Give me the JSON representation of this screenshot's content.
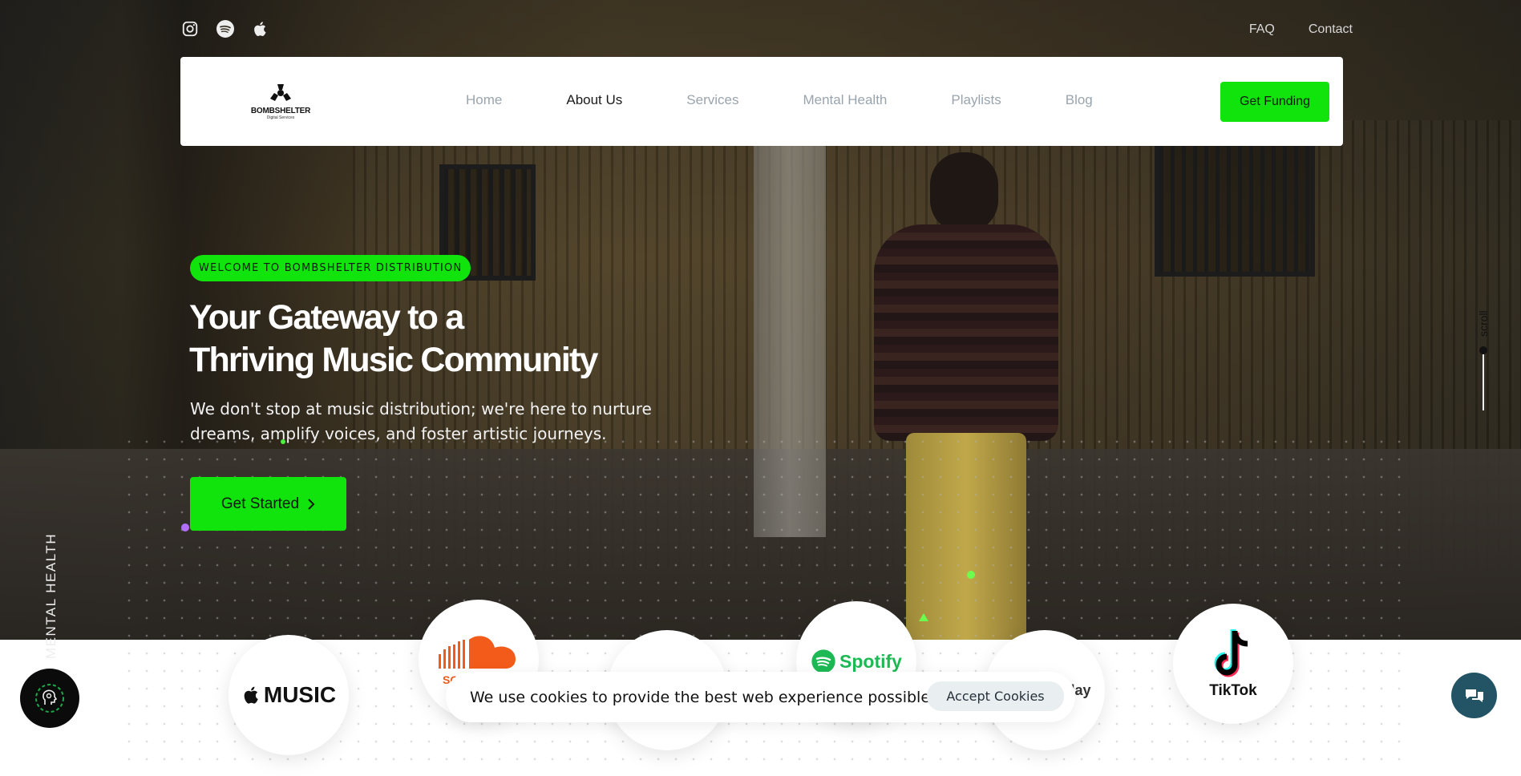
{
  "top_bar": {
    "socials": [
      "instagram-icon",
      "spotify-icon",
      "apple-icon"
    ],
    "links": [
      "FAQ",
      "Contact"
    ]
  },
  "navbar": {
    "logo": {
      "name": "BOMBSHELTER",
      "sub": "Digital Services"
    },
    "links": [
      "Home",
      "About Us",
      "Services",
      "Mental Health",
      "Playlists",
      "Blog"
    ],
    "active": "About Us",
    "cta": "Get Funding"
  },
  "hero": {
    "badge": "WELCOME TO BOMBSHELTER DISTRIBUTION",
    "headline_line1": "Your Gateway to a",
    "headline_line2": "Thriving Music Community",
    "subtext": "We don't stop at music distribution; we're here to nurture dreams, amplify voices, and foster artistic journeys.",
    "cta": "Get Started",
    "side_label": "MENTAL HEALTH",
    "scroll_label": "scroll"
  },
  "platforms": {
    "apple_music": "MUSIC",
    "soundcloud": "SOU",
    "spotify": "Spotify",
    "google_play": "lay",
    "tiktok": "TikTok"
  },
  "cookie": {
    "message": "We use cookies to provide the best web experience possible.",
    "accept": "Accept Cookies"
  },
  "colors": {
    "accent": "#11e40c",
    "chat": "#225466",
    "nav_text": "#9aa4ad"
  }
}
